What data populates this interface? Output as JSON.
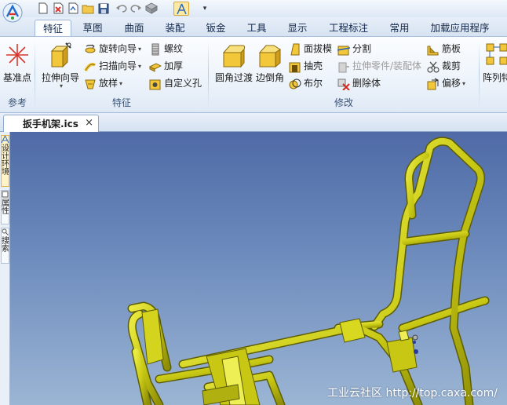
{
  "quick_access": {
    "logo_icon": "caxa-logo-icon",
    "buttons": [
      "new-file-icon",
      "open-template-icon",
      "new-drawing-icon",
      "open-folder-icon",
      "save-icon",
      "undo-icon",
      "redo-icon",
      "render-icon",
      "design-element-icon",
      "dropdown-icon"
    ]
  },
  "tabs": {
    "items": [
      "特征",
      "草图",
      "曲面",
      "装配",
      "钣金",
      "工具",
      "显示",
      "工程标注",
      "常用",
      "加载应用程序"
    ],
    "active": "特征"
  },
  "ribbon": {
    "reference": {
      "label": "参考",
      "base_point": "基准点"
    },
    "feature": {
      "label": "特征",
      "extrude_wizard": "拉伸向导",
      "revolve_wizard": "旋转向导",
      "sweep_wizard": "扫描向导",
      "loft": "放样",
      "thread": "螺纹",
      "thicken": "加厚",
      "custom_hole": "自定义孔"
    },
    "modify": {
      "label": "修改",
      "fillet": "圆角过渡",
      "chamfer": "边倒角",
      "draft": "面拔模",
      "shell": "抽壳",
      "boolean": "布尔",
      "split": "分割",
      "stretch_part": "拉伸零件/装配体",
      "delete_body": "删除体",
      "rib": "筋板",
      "trim": "裁剪",
      "offset": "偏移",
      "array": "阵列特"
    }
  },
  "document": {
    "tab_label": "扳手机架.ics",
    "close_symbol": "×"
  },
  "side_panel": {
    "tabs": [
      "设计环境",
      "属性",
      "搜索"
    ]
  },
  "viewport": {
    "watermark": "工业云社区 http://top.caxa.com/",
    "model_color": "#c8c814",
    "background_top": "#4f6aa6",
    "background_bottom": "#9bb5d4"
  }
}
